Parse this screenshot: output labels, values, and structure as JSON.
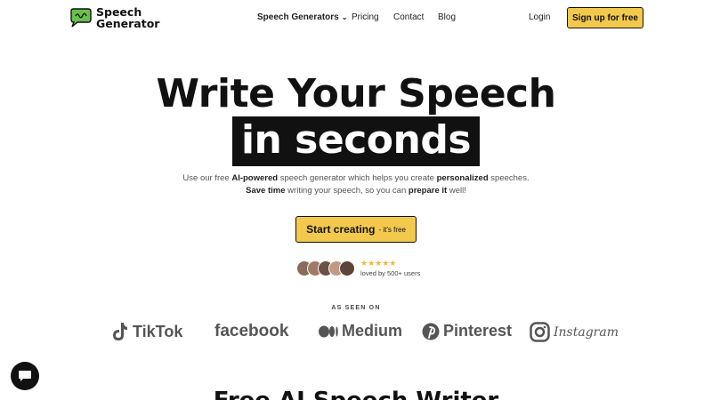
{
  "nav": {
    "logo_line1": "Speech",
    "logo_line2": "Generator",
    "links": [
      "Speech Generators",
      "Pricing",
      "Contact",
      "Blog"
    ],
    "login": "Login",
    "signup": "Sign up for free"
  },
  "hero": {
    "title_line1": "Write Your Speech",
    "title_line2": "in seconds",
    "sub1_pre": "Use our free ",
    "sub1_b1": "AI-powered",
    "sub1_mid": " speech generator which helps you create ",
    "sub1_b2": "personalized",
    "sub1_post": " speeches.",
    "sub2_b1": "Save time",
    "sub2_mid": " writing your speech, so you can ",
    "sub2_b2": "prepare it",
    "sub2_post": " well!",
    "cta_label": "Start creating",
    "cta_note": "- it's free",
    "stars": "★★★★★",
    "loved": "loved by 500+ users"
  },
  "seen_on": {
    "label": "AS SEEN ON",
    "brands": [
      "TikTok",
      "facebook",
      "Medium",
      "Pinterest",
      "Instagram"
    ]
  },
  "next_heading": "Free AI Speech Writer",
  "colors": {
    "accent": "#f2c94c",
    "logo_green": "#6abf4b",
    "star": "#f2b636"
  }
}
